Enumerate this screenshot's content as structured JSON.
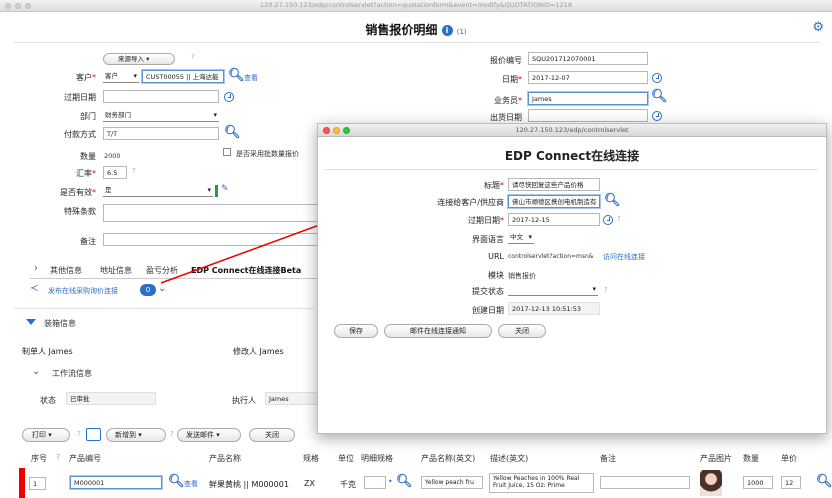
{
  "window": {
    "url": "120.27.150.123/edp/controlservlet?action=quotationform&event=modify&QUOTATIONID=1218"
  },
  "header": {
    "title": "销售报价明细",
    "info_icon": "info-icon",
    "count": "(1)",
    "settings_icon": "gear-icon"
  },
  "form_left": {
    "source_import": "来源导入",
    "question_mark": "?",
    "customer_label": "客户",
    "customer_type": "客户",
    "customer_value": "CUST00055 || 上海达能",
    "view_link": "查看",
    "expiry_label": "过期日期",
    "department_label": "部门",
    "department_value": "财务部门",
    "payment_label": "付款方式",
    "payment_value": "T/T",
    "quantity_label": "数量",
    "quantity_value": "2000",
    "batch_checkbox_label": "是否采用批数量报价",
    "rate_label": "汇率",
    "rate_value": "6.5",
    "valid_label": "是否有效",
    "valid_value": "是",
    "special_label": "特殊条款",
    "remark_label": "备注"
  },
  "form_right": {
    "quote_no_label": "报价编号",
    "quote_no_value": "SQU201712070001",
    "date_label": "日期",
    "date_value": "2017-12-07",
    "sales_label": "业务员",
    "sales_value": "James",
    "ship_date_label": "出货日期"
  },
  "tabs": [
    "其他信息",
    "地址信息",
    "盈亏分析",
    "EDP Connect在线连接Beta"
  ],
  "publish_link": "发布在线采购询价连接",
  "publish_count": "0",
  "packing_label": "装箱信息",
  "creator_label": "制单人",
  "creator_value": "James",
  "modifier_label": "修改人",
  "modifier_value": "James",
  "workflow_label": "工作流信息",
  "status_label": "状态",
  "status_value": "已审批",
  "executor_label": "执行人",
  "executor_value": "James",
  "toolbar": {
    "print": "打印",
    "q": "?",
    "add": "新增到",
    "send_mail": "发送邮件",
    "close": "关闭"
  },
  "table": {
    "headers": [
      "序号",
      "?",
      "产品编号",
      "产品名称",
      "规格",
      "单位",
      "明细规格",
      "产品名称(英文)",
      "描述(英文)",
      "备注",
      "产品图片",
      "数量",
      "单价"
    ],
    "row": {
      "seq": "1",
      "code": "M000001",
      "view": "查看",
      "name": "鲜果黄桃 || M000001",
      "spec": "ZX",
      "unit": "千克",
      "en_name": "Yellow peach fru",
      "en_desc": "Yellow Peaches in 100% Real Fruit Juice, 15 Oz: Prime",
      "qty": "1000",
      "price": "12"
    }
  },
  "popup": {
    "url": "120.27.150.123/edp/controlservlet",
    "title": "EDP Connect在线连接",
    "title_label": "标题",
    "title_value": "请尽快回复这些产品价格",
    "target_label": "连接给客户/供应商",
    "target_value": "佛山市顺德区携创电机制造有",
    "expiry_label": "过期日期",
    "expiry_value": "2017-12-15",
    "lang_label": "界面语言",
    "lang_value": "中文",
    "url_label": "URL",
    "url_value": "controlservlet?action=msn&",
    "visit_link": "访问在线连接",
    "module_label": "模块",
    "module_value": "销售报价",
    "submit_label": "提交状态",
    "created_label": "创建日期",
    "created_value": "2017-12-13 10:51:53",
    "save_btn": "保存",
    "mail_btn": "邮件在线连接通知",
    "close_btn": "关闭"
  }
}
